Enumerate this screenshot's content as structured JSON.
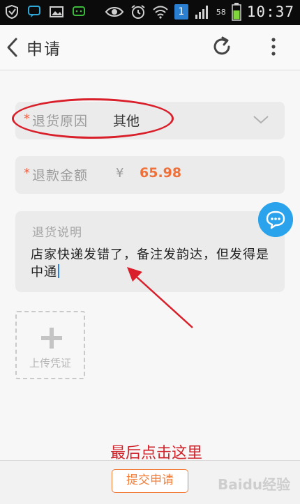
{
  "status_bar": {
    "battery_percent": "58",
    "time": "10:37",
    "sim_badge": "1"
  },
  "app_bar": {
    "title": "申请"
  },
  "form": {
    "reason": {
      "required_mark": "*",
      "label": "退货原因",
      "value": "其他"
    },
    "amount": {
      "required_mark": "*",
      "label": "退款金额",
      "currency": "¥",
      "value": "65.98"
    },
    "description": {
      "label": "退货说明",
      "text": "店家快递发错了，备注发韵达，但发得是中通"
    },
    "upload": {
      "label": "上传凭证"
    }
  },
  "annotation": {
    "note": "最后点击这里"
  },
  "bottom_bar": {
    "submit_label": "提交申请",
    "watermark": "Baidu经验"
  },
  "colors": {
    "accent_orange": "#f27f3c",
    "required_red": "#f06449",
    "annotation_red": "#d81f2a",
    "chat_blue": "#2aa3ec"
  }
}
